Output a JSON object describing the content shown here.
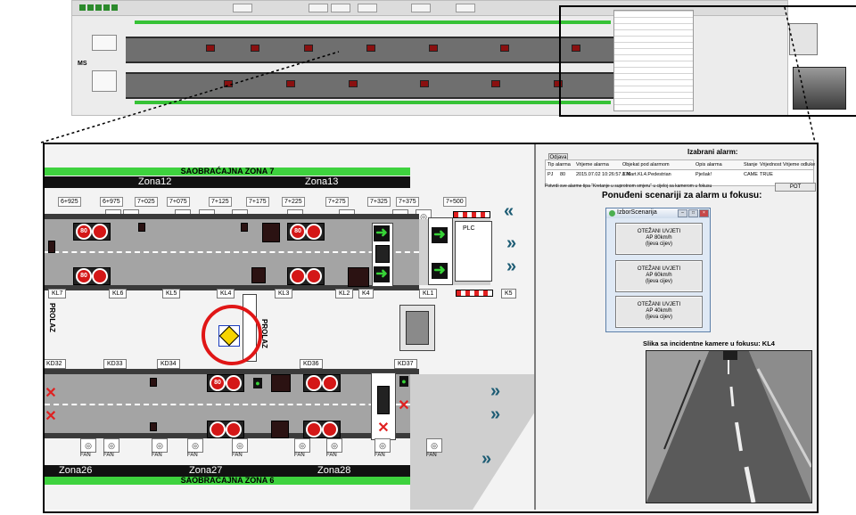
{
  "overview": {
    "ms_label": "MS"
  },
  "tunnel": {
    "traffic_zone_top": "SAOBRAĆAJNA ZONA 7",
    "traffic_zone_bottom": "SAOBRAĆAJNA ZONA 6",
    "zones_top": [
      "Zona12",
      "Zona13"
    ],
    "zones_bottom": [
      "Zona26",
      "Zona27",
      "Zona28"
    ],
    "km_markers": [
      "6+925",
      "6+975",
      "7+025",
      "7+075",
      "7+125",
      "7+175",
      "7+225",
      "7+275",
      "7+325",
      "7+375",
      "7+500"
    ],
    "kl_labels": [
      "KL7",
      "KL6",
      "KL5",
      "KL4",
      "KL3",
      "KL2",
      "K4",
      "KL1",
      "K5"
    ],
    "kd_labels": [
      "KD32",
      "KD33",
      "KD34",
      "KD36",
      "KD37"
    ],
    "left_text": "PROLAZ",
    "mid_text_a": "PROLAZ",
    "mid_text_b": "KI",
    "plc_label": "PLC",
    "sign_labels": [
      "80",
      "80",
      "80",
      "80"
    ],
    "fan_labels": [
      "FAN",
      "FAN",
      "FAN",
      "FAN",
      "FAN",
      "FAN",
      "FAN",
      "FAN",
      "FAN"
    ]
  },
  "alarm": {
    "odjava_btn": "Odjava",
    "selected_alarm_title": "Izabrani alarm:",
    "table_headers": [
      "Tip alarma",
      "Vrijeme alarma",
      "Objekat pod alarmom",
      "Opis alarma",
      "Stanje",
      "Vrijednost",
      "Vrijeme odluke"
    ],
    "table_row": [
      "PJ",
      "80",
      "2015.07.02 10:26:57.876",
      "1.Mart.KL4.Pedestrian",
      "Pješak!",
      "CAME",
      "TRUE"
    ],
    "confirm_text": "Potvrdi sve alarme tipa \"Kretanje u suprotnom smjeru\" u cijeloj sa kamerom u fokusu",
    "confirm_btn": "POT",
    "scenarios_title": "Ponuđeni scenariji za alarm u fokusu:",
    "popup_title": "IzborScenarija",
    "scenario_buttons": [
      {
        "line1": "OTEŽANI UVJETI",
        "line2": "AP 80km/h",
        "line3": "(ljeva cijev)"
      },
      {
        "line1": "OTEŽANI UVJETI",
        "line2": "AP 60km/h",
        "line3": "(ljeva cijev)"
      },
      {
        "line1": "OTEŽANI UVJETI",
        "line2": "AP 40km/h",
        "line3": "(ljeva cijev)"
      }
    ],
    "camera_title": "Slika sa incidentne kamere u fokusu: KL4"
  },
  "colors": {
    "green": "#3ed23e",
    "signal_red": "#d41717",
    "highlight_ring": "#e01616",
    "chevron": "#1d5c74"
  }
}
